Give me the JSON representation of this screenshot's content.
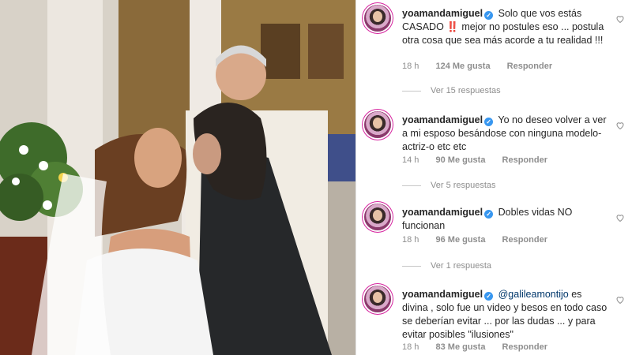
{
  "colors": {
    "accent": "#3897f0",
    "ring": "#d6249f",
    "muted": "#8e8e8e",
    "text": "#262626",
    "alert": "#e0143c"
  },
  "photo": {
    "description_icon": "wedding-photo"
  },
  "comments": [
    {
      "username": "yoamandamiguel",
      "parts": {
        "a": "Solo que vos estás CASADO ",
        "emoji": "‼️",
        "b": "mejor no postules eso ... postula otra cosa que sea más acorde a tu realidad !!!"
      },
      "time": "18 h",
      "likes": "124 Me gusta",
      "reply": "Responder",
      "replies": "Ver 15 respuestas"
    },
    {
      "username": "yoamandamiguel",
      "text": "Yo no deseo volver a ver a mi esposo besándose con ninguna modelo-actriz-o etc etc",
      "time": "14 h",
      "likes": "90 Me gusta",
      "reply": "Responder",
      "replies": "Ver 5 respuestas"
    },
    {
      "username": "yoamandamiguel",
      "text": "Dobles vidas NO funcionan",
      "time": "18 h",
      "likes": "96 Me gusta",
      "reply": "Responder",
      "replies": "Ver 1 respuesta"
    },
    {
      "username": "yoamandamiguel",
      "mention": "@galileamontijo",
      "text": " es divina , solo fue un video y besos en todo caso se deberían evitar ... por las dudas ... y para evitar posibles \"ilusiones\"",
      "time": "18 h",
      "likes": "83 Me gusta",
      "reply": "Responder"
    }
  ]
}
